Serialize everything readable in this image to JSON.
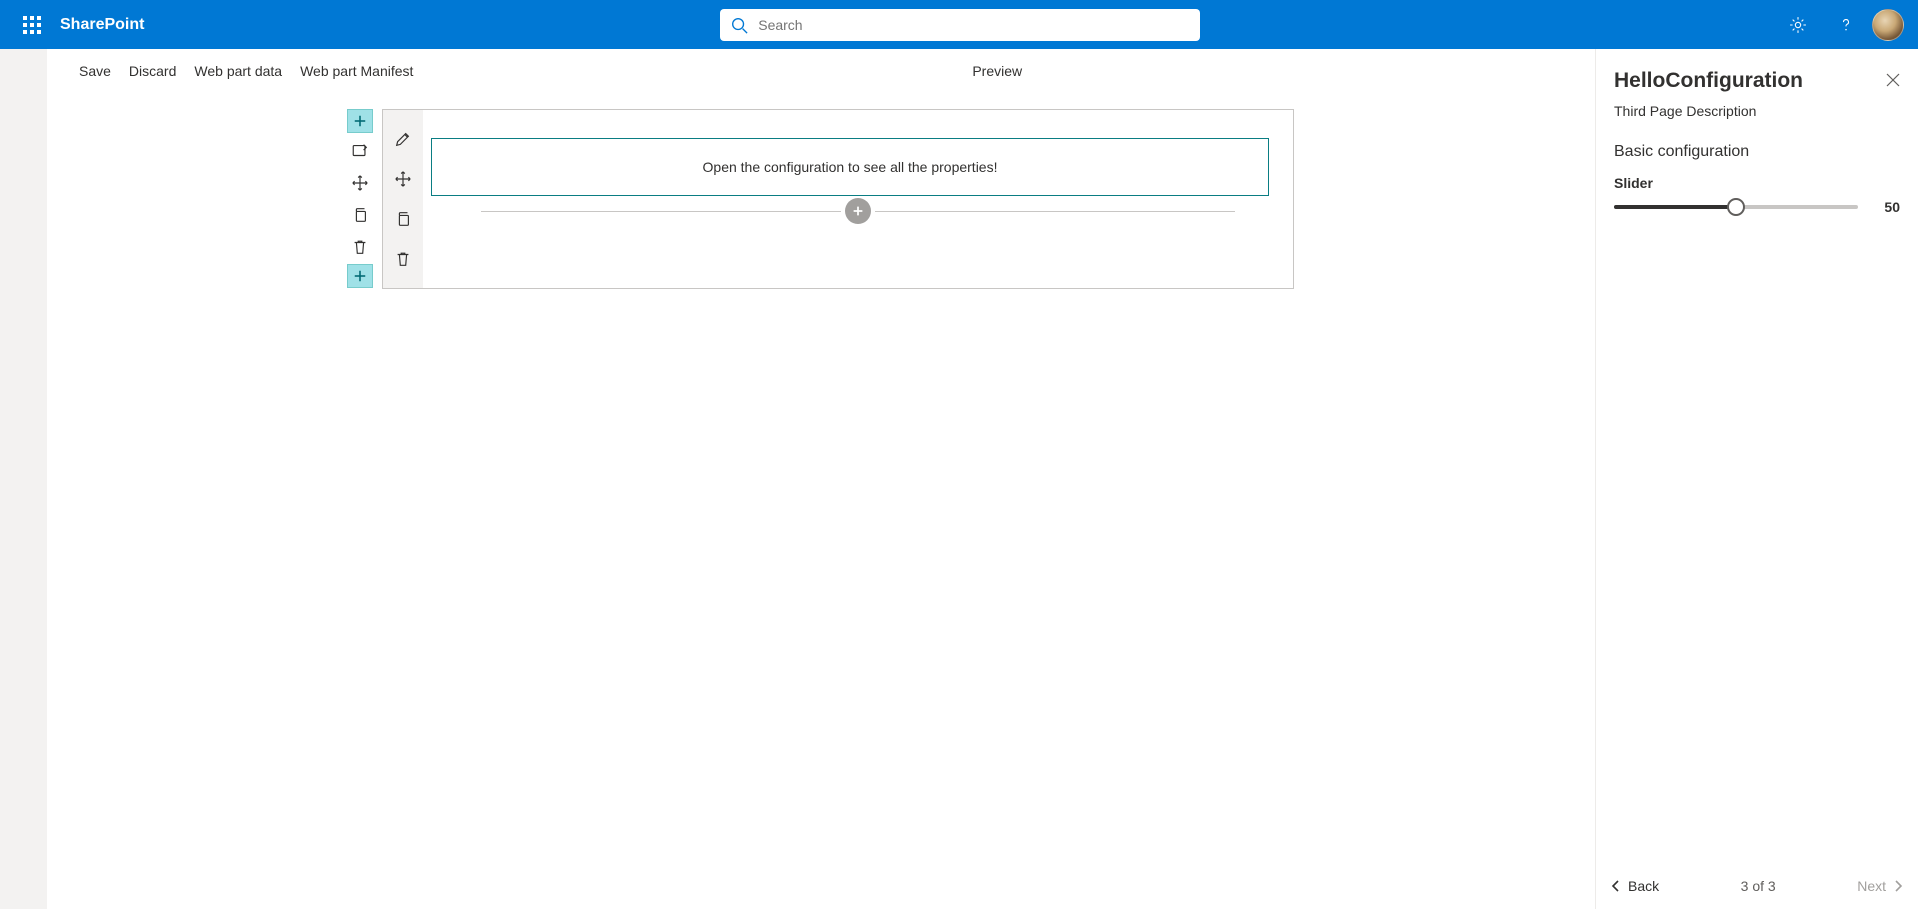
{
  "header": {
    "brand": "SharePoint",
    "search_placeholder": "Search"
  },
  "commands": {
    "save": "Save",
    "discard": "Discard",
    "webpart_data": "Web part data",
    "webpart_manifest": "Web part Manifest",
    "preview": "Preview"
  },
  "canvas": {
    "webpart_message": "Open the configuration to see all the properties!"
  },
  "pane": {
    "title": "HelloConfiguration",
    "description": "Third Page Description",
    "group_title": "Basic configuration",
    "slider_label": "Slider",
    "slider_value": "50",
    "slider_percent": 50,
    "back_label": "Back",
    "next_label": "Next",
    "pager": "3 of 3"
  }
}
